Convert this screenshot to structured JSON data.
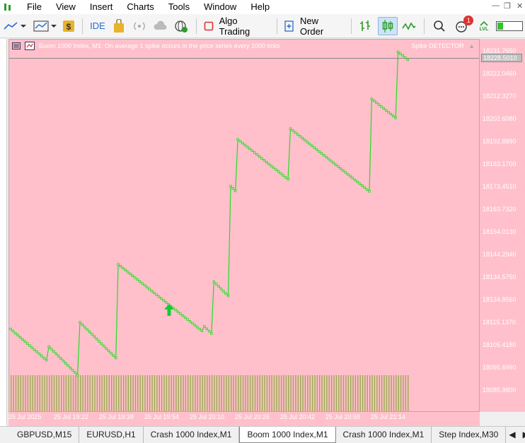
{
  "menu": {
    "items": [
      "File",
      "View",
      "Insert",
      "Charts",
      "Tools",
      "Window",
      "Help"
    ]
  },
  "toolbar": {
    "ide_label": "IDE",
    "algo_trading_label": "Algo Trading",
    "new_order_label": "New Order",
    "notification_count": "1",
    "lvl_label": "LVL"
  },
  "chart": {
    "header_text": "Boom 1000 Index, M1:  On average 1 spike occurs in the price series every 1000 ticks",
    "indicator_label": "Spike DETECTOR",
    "current_price": "18228.5010",
    "price_labels": [
      "18231.7650",
      "18222.0460",
      "18212.3270",
      "18202.6080",
      "18192.8890",
      "18183.1700",
      "18173.4510",
      "18163.7320",
      "18154.0130",
      "18144.2940",
      "18134.5750",
      "18124.8560",
      "18115.1370",
      "18105.4180",
      "18095.6990",
      "18085.9800"
    ],
    "time_labels": [
      "25 Jul 2025",
      "25 Jul 19:22",
      "25 Jul 19:38",
      "25 Jul 19:54",
      "25 Jul 20:10",
      "25 Jul 20:26",
      "25 Jul 20:42",
      "25 Jul 20:58",
      "25 Jul 21:14"
    ],
    "colors": {
      "background": "#ffc0cb",
      "line": "#22dd22",
      "volume": "#9aaa50",
      "arrow": "#11cc33"
    }
  },
  "chart_data": {
    "type": "line",
    "title": "Boom 1000 Index, M1",
    "ylim": [
      18080,
      18234
    ],
    "series": [
      {
        "name": "Boom 1000 Index",
        "values": [
          18115.2,
          18114.3,
          18113.4,
          18112.6,
          18111.7,
          18110.8,
          18109.9,
          18109.1,
          18108.2,
          18107.3,
          18106.4,
          18105.6,
          18104.7,
          18103.8,
          18102.9,
          18102.1,
          18107.8,
          18106.8,
          18105.8,
          18104.8,
          18103.8,
          18102.8,
          18101.8,
          18100.8,
          18099.8,
          18098.8,
          18097.8,
          18096.8,
          18095.8,
          18118.0,
          18117.0,
          18116.0,
          18115.0,
          18114.0,
          18113.0,
          18112.0,
          18111.0,
          18110.0,
          18109.0,
          18108.0,
          18107.0,
          18106.0,
          18105.0,
          18104.0,
          18103.0,
          18142.4,
          18141.6,
          18140.8,
          18140.0,
          18139.2,
          18138.4,
          18137.6,
          18136.8,
          18136.0,
          18135.2,
          18134.4,
          18133.6,
          18132.8,
          18132.0,
          18131.2,
          18130.4,
          18129.6,
          18128.8,
          18128.0,
          18127.2,
          18126.4,
          18125.6,
          18124.8,
          18124.0,
          18123.2,
          18122.4,
          18121.6,
          18120.8,
          18120.0,
          18119.2,
          18118.4,
          18117.6,
          18116.8,
          18116.0,
          18115.2,
          18114.4,
          18116.3,
          18115.3,
          18114.3,
          18113.3,
          18135.1,
          18134.1,
          18133.1,
          18132.1,
          18131.1,
          18130.1,
          18129.1,
          18175.3,
          18174.3,
          18173.3,
          18195.0,
          18194.2,
          18193.4,
          18192.6,
          18191.8,
          18191.0,
          18190.2,
          18189.4,
          18188.6,
          18187.8,
          18187.0,
          18186.2,
          18185.4,
          18184.6,
          18183.8,
          18183.0,
          18182.2,
          18181.4,
          18180.6,
          18179.8,
          18179.0,
          18178.2,
          18199.5,
          18198.7,
          18197.9,
          18197.1,
          18196.3,
          18195.5,
          18194.7,
          18193.9,
          18193.1,
          18192.3,
          18191.5,
          18190.7,
          18189.9,
          18189.1,
          18188.3,
          18187.5,
          18186.7,
          18185.9,
          18185.1,
          18184.3,
          18183.5,
          18182.7,
          18181.9,
          18181.1,
          18180.3,
          18179.5,
          18178.7,
          18177.9,
          18177.1,
          18176.3,
          18175.5,
          18174.7,
          18173.9,
          18173.1,
          18212.0,
          18211.2,
          18210.4,
          18209.6,
          18208.8,
          18208.0,
          18207.2,
          18206.4,
          18205.6,
          18204.8,
          18204.0,
          18231.8,
          18231.0,
          18230.2,
          18229.4,
          18228.5
        ]
      }
    ],
    "volumes_relative": 0.8,
    "annotations": [
      {
        "type": "up-arrow",
        "near": "25 Jul 19:54"
      }
    ]
  }
}
